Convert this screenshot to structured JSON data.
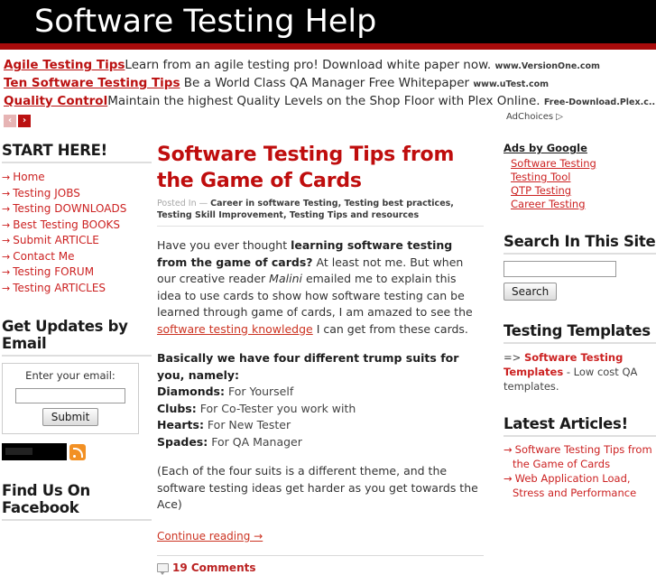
{
  "header": {
    "site_title": "Software Testing Help"
  },
  "top_ads": {
    "ads": [
      {
        "title": "Agile Testing Tips",
        "description": "Learn from an agile testing pro! Download white paper now.",
        "url": "www.VersionOne.com"
      },
      {
        "title": "Ten Software Testing Tips",
        "description": "Be a World Class QA Manager Free Whitepaper",
        "url": "www.uTest.com"
      },
      {
        "title": "Quality Control",
        "description": "Maintain the highest Quality Levels on the Shop Floor with Plex Online.",
        "url": "Free-Download.Plex.c..."
      }
    ],
    "prev_arrow": "‹",
    "next_arrow": "›",
    "adchoices_label": "AdChoices",
    "adchoices_glyph": "▷"
  },
  "left_sidebar": {
    "start_here": {
      "title": "START HERE!",
      "arrow": "→",
      "items": [
        {
          "label": "Home"
        },
        {
          "label": "Testing JOBS"
        },
        {
          "label": "Testing DOWNLOADS"
        },
        {
          "label": "Best Testing BOOKS"
        },
        {
          "label": "Submit ARTICLE"
        },
        {
          "label": "Contact Me"
        },
        {
          "label": "Testing FORUM"
        },
        {
          "label": "Testing ARTICLES"
        }
      ]
    },
    "subscribe": {
      "title": "Get Updates by Email",
      "field_label": "Enter your email:",
      "email_value": "",
      "email_placeholder": "",
      "submit_label": "Submit"
    },
    "facebook": {
      "title": "Find Us On Facebook"
    }
  },
  "main": {
    "post_title": "Software Testing Tips from the Game of Cards",
    "posted_in_label": "Posted In —",
    "categories": "Career in software Testing, Testing best practices, Testing Skill Improvement, Testing Tips and resources",
    "paragraph1": {
      "part1": "Have you ever thought ",
      "bold1": "learning software testing from the game of cards?",
      "part2": " At least not me. But when our creative reader ",
      "italic1": "Malini",
      "part3": " emailed me to explain this idea to use cards to show how software testing can be learned through game of cards, I am amazed to see the ",
      "link": "software testing knowledge",
      "part4": " I can get from these cards."
    },
    "suits_intro": "Basically we have four different trump suits for you, namely:",
    "suits": [
      {
        "name": "Diamonds:",
        "desc": " For Yourself"
      },
      {
        "name": "Clubs:",
        "desc": " For Co-Tester you work with"
      },
      {
        "name": "Hearts:",
        "desc": " For New Tester"
      },
      {
        "name": "Spades:",
        "desc": " For QA Manager"
      }
    ],
    "note": "(Each of the four suits is a different theme, and the software testing ideas get harder as you get towards the Ace)",
    "continue_label": "Continue reading →",
    "comments_label": "19 Comments"
  },
  "right_sidebar": {
    "google_ads": {
      "title": "Ads by Google",
      "links": [
        {
          "label": "Software Testing"
        },
        {
          "label": "Testing Tool"
        },
        {
          "label": "QTP Testing"
        },
        {
          "label": "Career Testing"
        }
      ]
    },
    "search": {
      "title": "Search In This Site",
      "value": "",
      "placeholder": "",
      "button_label": "Search"
    },
    "templates": {
      "title": "Testing Templates",
      "prefix": "=> ",
      "link": "Software Testing Templates",
      "suffix": " - Low cost QA templates."
    },
    "latest": {
      "title": "Latest Articles!",
      "arrow": "→",
      "items": [
        {
          "label": "Software Testing Tips from the Game of Cards"
        },
        {
          "label": "Web Application Load, Stress and Performance"
        }
      ]
    }
  },
  "colors": {
    "header_bg": "#000000",
    "header_rule": "#a80b0b",
    "accent_red": "#bf0d0d",
    "link_red": "#cc2222",
    "text": "#333333"
  }
}
